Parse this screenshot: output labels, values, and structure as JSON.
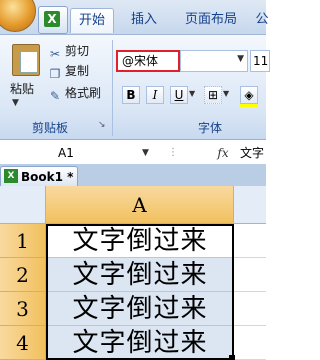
{
  "ribbon": {
    "tabs": [
      "开始",
      "插入",
      "页面布局",
      "公"
    ],
    "active_tab": "开始",
    "clipboard": {
      "paste": "粘贴",
      "cut": "剪切",
      "copy": "复制",
      "format_painter": "格式刷",
      "group_label": "剪贴板"
    },
    "font": {
      "name": "@宋体",
      "size": "11",
      "group_label": "字体",
      "bold": "B",
      "italic": "I",
      "underline": "U"
    }
  },
  "formula_bar": {
    "name_box": "A1",
    "fx": "fx",
    "value": "文字"
  },
  "workbook": {
    "tab_title": "Book1 *"
  },
  "sheet": {
    "column": "A",
    "rows": [
      {
        "num": "1",
        "text": "文字倒过来"
      },
      {
        "num": "2",
        "text": "文字倒过来"
      },
      {
        "num": "3",
        "text": "文字倒过来"
      },
      {
        "num": "4",
        "text": "文字倒过来"
      }
    ]
  },
  "colors": {
    "highlight_border": "#e0202a",
    "header_active": "#f1c15f",
    "ribbon_bg": "#dbe7f6"
  }
}
